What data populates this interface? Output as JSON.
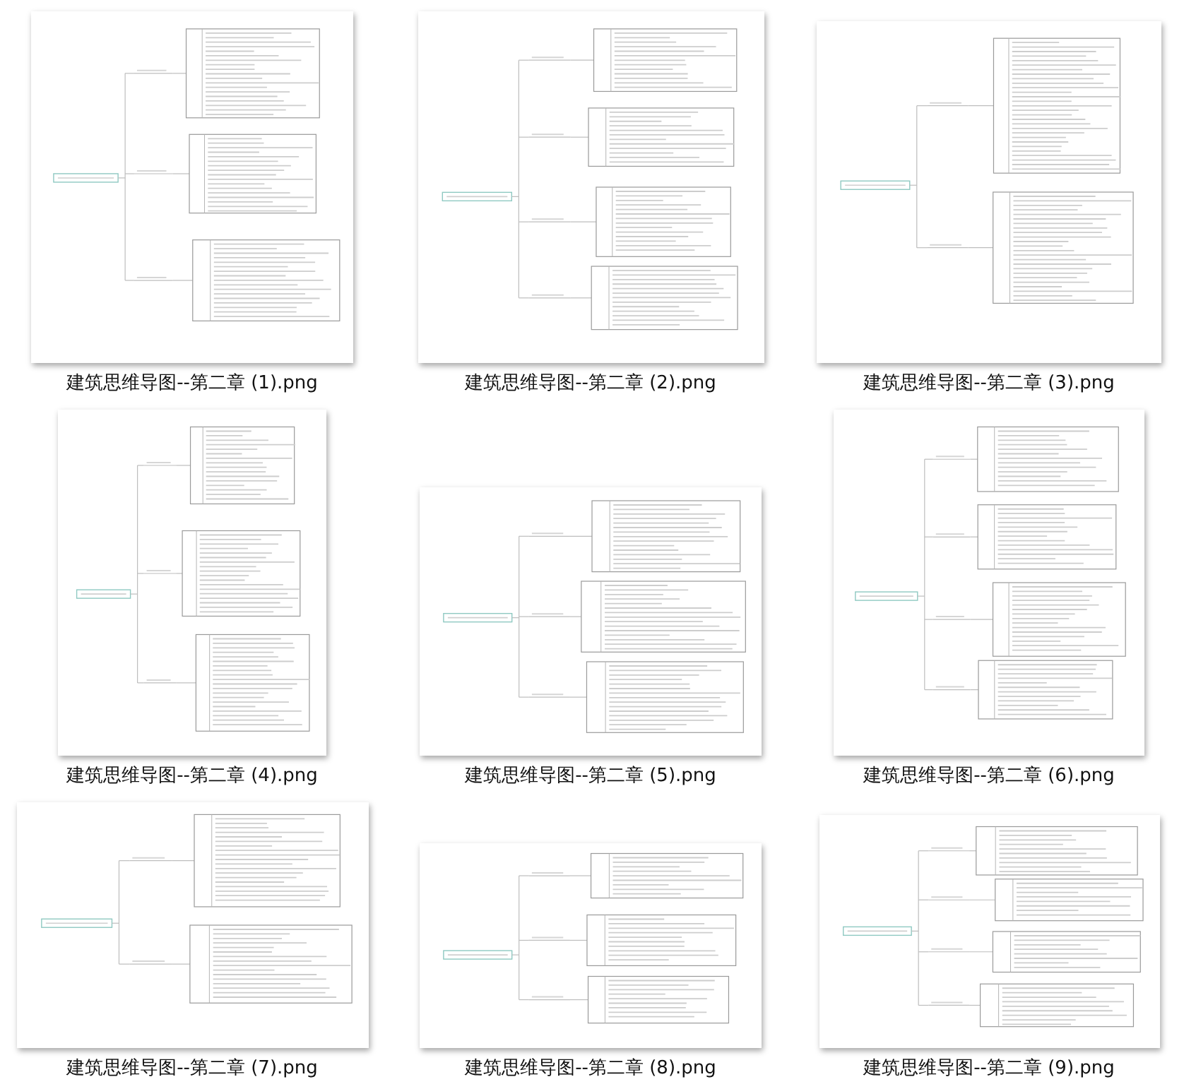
{
  "files": [
    {
      "name": "建筑思维导图--第二章 (1).png"
    },
    {
      "name": "建筑思维导图--第二章 (2).png"
    },
    {
      "name": "建筑思维导图--第二章 (3).png"
    },
    {
      "name": "建筑思维导图--第二章 (4).png"
    },
    {
      "name": "建筑思维导图--第二章 (5).png"
    },
    {
      "name": "建筑思维导图--第二章 (6).png"
    },
    {
      "name": "建筑思维导图--第二章 (7).png"
    },
    {
      "name": "建筑思维导图--第二章 (8).png"
    },
    {
      "name": "建筑思维导图--第二章 (9).png"
    }
  ]
}
